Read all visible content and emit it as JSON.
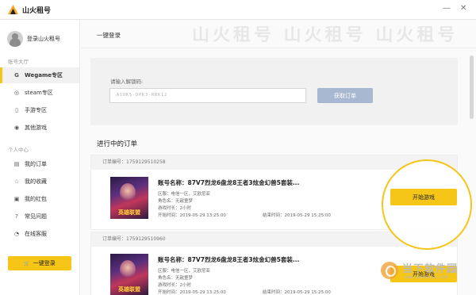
{
  "app": {
    "title": "山火租号"
  },
  "window_controls": {
    "minimize": "—",
    "close": "✕"
  },
  "sidebar": {
    "login_text": "登录山火租号",
    "section_hall": "账号大厅",
    "hall_items": [
      {
        "label": "Wegame专区",
        "icon": "G"
      },
      {
        "label": "steam专区",
        "icon": "◎"
      },
      {
        "label": "手游专区",
        "icon": "▯"
      },
      {
        "label": "其他游戏",
        "icon": "◉"
      }
    ],
    "section_user": "个人中心",
    "user_items": [
      {
        "label": "我的订单",
        "icon": "▤"
      },
      {
        "label": "我的收藏",
        "icon": "☆"
      },
      {
        "label": "我的红包",
        "icon": "▣"
      },
      {
        "label": "常见问题",
        "icon": "?"
      },
      {
        "label": "在线客服",
        "icon": "◔"
      }
    ],
    "onekey_button": "一键登录",
    "onekey_icon": "🛒"
  },
  "main": {
    "breadcrumb": "一键登录",
    "watermark": "山火租号 山火租号 山火租号",
    "unlock_label": "请输入解锁码:",
    "unlock_value": "ASUK5-DPK3-RRK12",
    "fetch_button": "获取订单",
    "orders_title": "进行中的订单",
    "orders": [
      {
        "order_no": "订单编号：1759129510258",
        "name": "账号名称：87V7烈龙6盘龙8王者3炫金幻兽5套装...",
        "region": "区服：电信一区，艾欧尼亚",
        "role": "角色名：无敌童梦",
        "duration": "游戏时长：2小时",
        "start_time": "开始时间：2019-05-29 13:25:00",
        "end_time": "结束时间：2019-05-29 15:25:00",
        "thumb_label": "英雄联盟",
        "start_button": "开始游戏"
      },
      {
        "order_no": "订单编号：1759129510960",
        "name": "账号名称：87V7烈龙6盘龙8王者3炫金幻兽5套装...",
        "region": "区服：电信一区，艾欧尼亚",
        "role": "角色名：无敌童梦",
        "duration": "游戏时长：2小时",
        "start_time": "开始时间：2019-05-29 13:25:00",
        "end_time": "结束时间：2019-05-29 15:25:00",
        "thumb_label": "英雄联盟",
        "start_button": "开始游戏"
      }
    ]
  },
  "site_watermark": {
    "name": "当下软件园",
    "url": "www.downxia.com"
  },
  "colors": {
    "accent": "#f5c518",
    "fetch_button": "#a9b8d1"
  }
}
